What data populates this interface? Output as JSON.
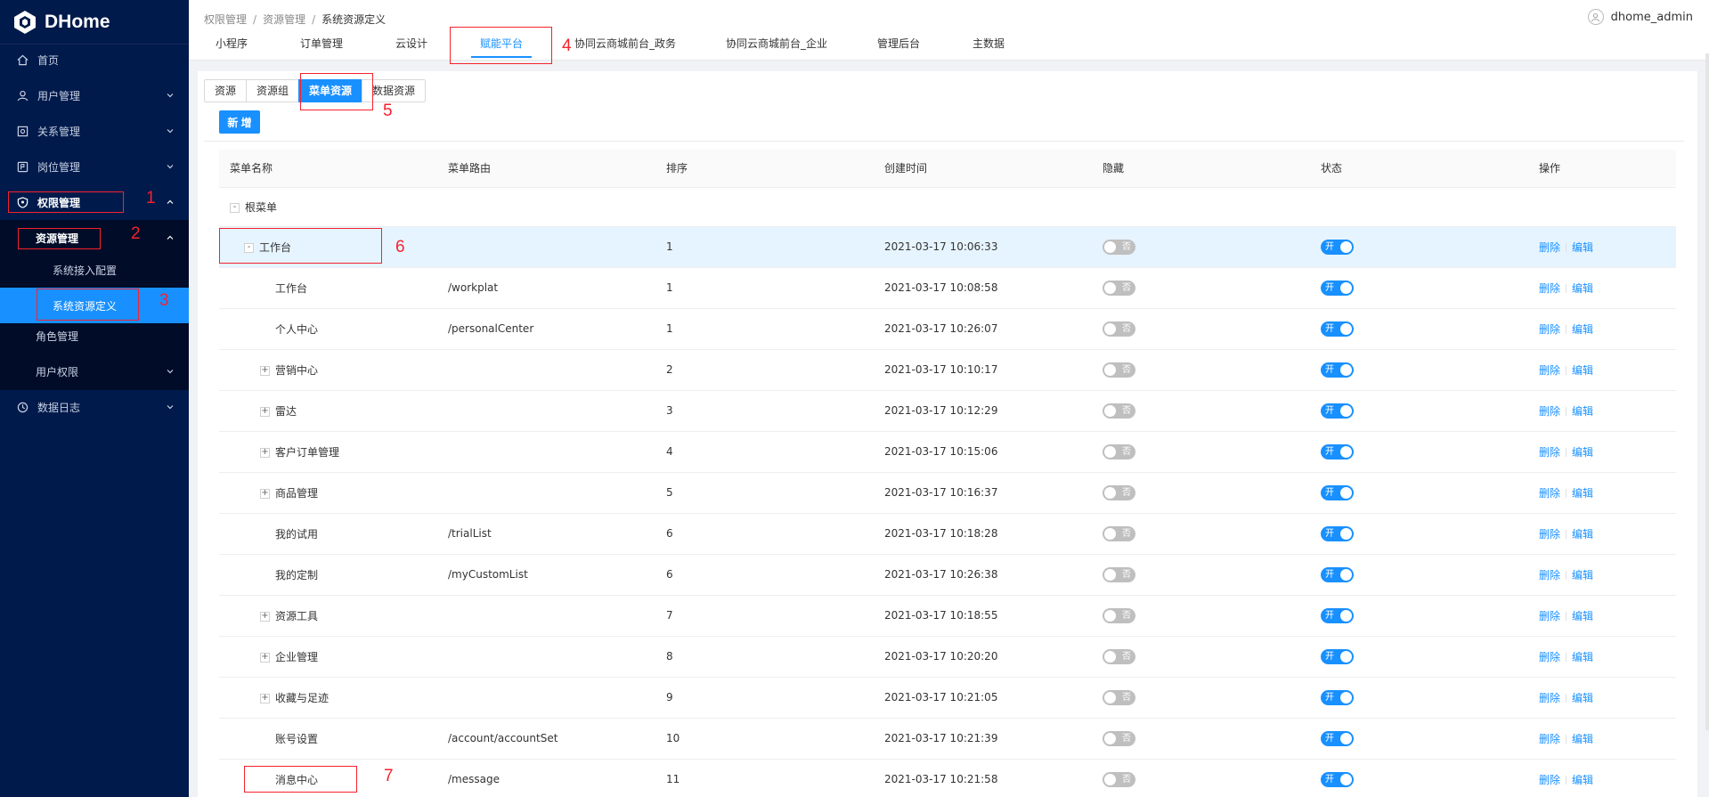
{
  "app": {
    "name": "DHome"
  },
  "user": {
    "name": "dhome_admin"
  },
  "breadcrumb": [
    "权限管理",
    "资源管理",
    "系统资源定义"
  ],
  "sidebar": {
    "items": [
      {
        "label": "首页",
        "icon": "home-icon"
      },
      {
        "label": "用户管理",
        "icon": "user-icon"
      },
      {
        "label": "关系管理",
        "icon": "relation-icon"
      },
      {
        "label": "岗位管理",
        "icon": "post-icon"
      },
      {
        "label": "权限管理",
        "icon": "shield-icon"
      },
      {
        "label": "资源管理"
      },
      {
        "label": "系统接入配置"
      },
      {
        "label": "系统资源定义"
      },
      {
        "label": "角色管理"
      },
      {
        "label": "用户权限"
      },
      {
        "label": "数据日志",
        "icon": "log-icon"
      }
    ]
  },
  "tabs": [
    "小程序",
    "订单管理",
    "云设计",
    "赋能平台",
    "协同云商城前台_政务",
    "协同云商城前台_企业",
    "管理后台",
    "主数据"
  ],
  "active_tab": "赋能平台",
  "subtabs": [
    "资源",
    "资源组",
    "菜单资源",
    "数据资源"
  ],
  "active_subtab": "菜单资源",
  "add_button": "新 增",
  "table": {
    "columns": [
      "菜单名称",
      "菜单路由",
      "排序",
      "创建时间",
      "隐藏",
      "状态",
      "操作"
    ],
    "switch_off_text": "否",
    "switch_on_text": "开",
    "actions": {
      "delete": "删除",
      "edit": "编辑"
    },
    "root": {
      "toggle": "-",
      "name": "根菜单"
    },
    "rows": [
      {
        "toggle": "-",
        "name": "工作台",
        "route": "",
        "order": "1",
        "created": "2021-03-17 10:06:33"
      },
      {
        "toggle": "",
        "name": "工作台",
        "route": "/workplat",
        "order": "1",
        "created": "2021-03-17 10:08:58"
      },
      {
        "toggle": "",
        "name": "个人中心",
        "route": "/personalCenter",
        "order": "1",
        "created": "2021-03-17 10:26:07"
      },
      {
        "toggle": "+",
        "name": "营销中心",
        "route": "",
        "order": "2",
        "created": "2021-03-17 10:10:17"
      },
      {
        "toggle": "+",
        "name": "雷达",
        "route": "",
        "order": "3",
        "created": "2021-03-17 10:12:29"
      },
      {
        "toggle": "+",
        "name": "客户订单管理",
        "route": "",
        "order": "4",
        "created": "2021-03-17 10:15:06"
      },
      {
        "toggle": "+",
        "name": "商品管理",
        "route": "",
        "order": "5",
        "created": "2021-03-17 10:16:37"
      },
      {
        "toggle": "",
        "name": "我的试用",
        "route": "/trialList",
        "order": "6",
        "created": "2021-03-17 10:18:28"
      },
      {
        "toggle": "",
        "name": "我的定制",
        "route": "/myCustomList",
        "order": "6",
        "created": "2021-03-17 10:26:38"
      },
      {
        "toggle": "+",
        "name": "资源工具",
        "route": "",
        "order": "7",
        "created": "2021-03-17 10:18:55"
      },
      {
        "toggle": "+",
        "name": "企业管理",
        "route": "",
        "order": "8",
        "created": "2021-03-17 10:20:20"
      },
      {
        "toggle": "+",
        "name": "收藏与足迹",
        "route": "",
        "order": "9",
        "created": "2021-03-17 10:21:05"
      },
      {
        "toggle": "",
        "name": "账号设置",
        "route": "/account/accountSet",
        "order": "10",
        "created": "2021-03-17 10:21:39"
      },
      {
        "toggle": "",
        "name": "消息中心",
        "route": "/message",
        "order": "11",
        "created": "2021-03-17 10:21:58"
      }
    ]
  },
  "annotations": [
    "1",
    "2",
    "3",
    "4",
    "5",
    "6",
    "7"
  ],
  "colors": {
    "sidebar_bg": "#001a4b",
    "accent": "#1890ff",
    "annotation": "#f5222d",
    "highlight_row": "#e6f4ff"
  }
}
